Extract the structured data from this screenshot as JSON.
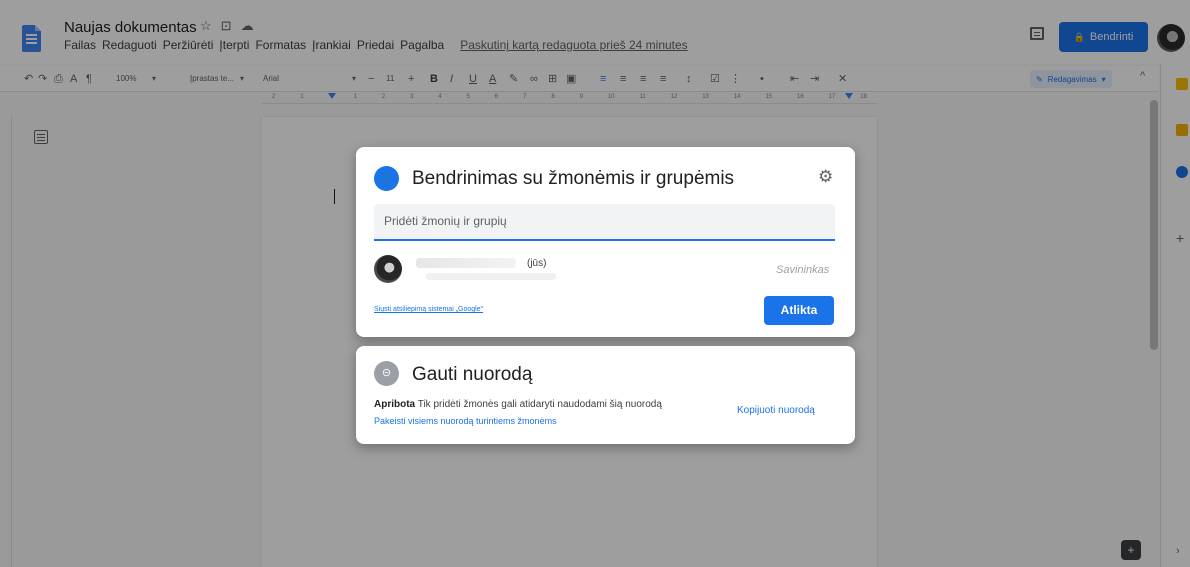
{
  "document": {
    "title": "Naujas dokumentas",
    "menu": [
      "Failas",
      "Redaguoti",
      "Peržiūrėti",
      "Įterpti",
      "Formatas",
      "Įrankiai",
      "Priedai",
      "Pagalba"
    ],
    "last_edit": "Paskutinį kartą redaguota prieš 24 minutes",
    "share_button": "Bendrinti"
  },
  "toolbar": {
    "zoom": "100%",
    "style": "Įprastas te...",
    "font": "Arial",
    "font_size": "11",
    "mode": "Redagavimas"
  },
  "ruler": [
    "2",
    "1",
    "",
    "1",
    "2",
    "3",
    "4",
    "5",
    "6",
    "7",
    "8",
    "9",
    "10",
    "11",
    "12",
    "13",
    "14",
    "15",
    "16",
    "17",
    "18"
  ],
  "share_dialog": {
    "title": "Bendrinimas su žmonėmis ir grupėmis",
    "input_placeholder": "Pridėti žmonių ir grupių",
    "owner_you": "(jūs)",
    "owner_role": "Savininkas",
    "feedback_link": "Siųsti atsiliepimą sistemai „Google\"",
    "done_button": "Atlikta"
  },
  "link_dialog": {
    "title": "Gauti nuorodą",
    "access_bold": "Apribota",
    "access_text": "Tik pridėti žmonės gali atidaryti naudodami šią nuorodą",
    "change_link": "Pakeisti visiems nuorodą turintiems žmonėms",
    "copy_link": "Kopijuoti nuorodą"
  },
  "colors": {
    "accent": "#1a73e8",
    "overlay": "rgba(0,0,0,0.38)"
  },
  "icons": [
    "docs-icon",
    "star-icon",
    "folder-icon",
    "cloud-icon",
    "comments-icon",
    "lock-icon",
    "undo-icon",
    "redo-icon",
    "print-icon",
    "spellcheck-icon",
    "paint-format-icon",
    "bold-icon",
    "italic-icon",
    "underline-icon",
    "text-color-icon",
    "highlight-icon",
    "link-icon",
    "comment-add-icon",
    "image-icon",
    "align-left-icon",
    "align-center-icon",
    "align-right-icon",
    "justify-icon",
    "line-spacing-icon",
    "checklist-icon",
    "bulleted-list-icon",
    "numbered-list-icon",
    "indent-decrease-icon",
    "indent-increase-icon",
    "clear-format-icon",
    "pencil-icon",
    "chevron-up-icon",
    "share-person-icon",
    "gear-icon",
    "link-chain-icon",
    "outline-icon",
    "explore-icon",
    "chevron-right-icon"
  ]
}
